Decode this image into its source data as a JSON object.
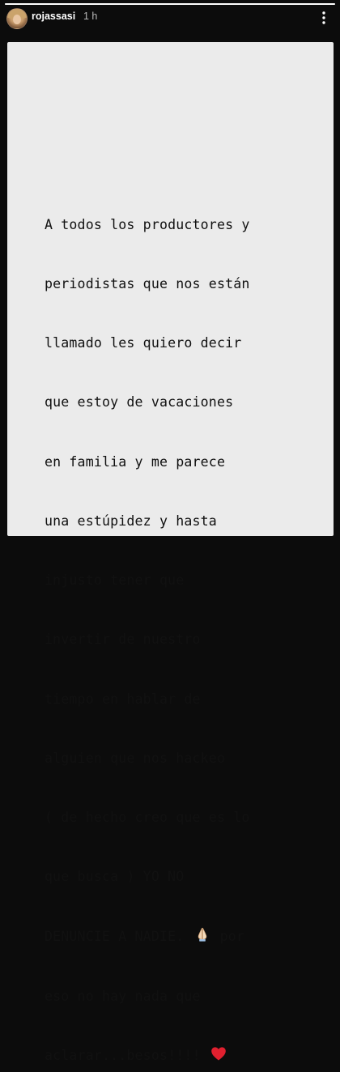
{
  "story": {
    "progress": 1.0,
    "username": "rojassasi",
    "timestamp": "1 h",
    "menu_icon": "more-dots-icon"
  },
  "message": {
    "lines": [
      "A todos los productores y",
      "periodistas que nos están",
      "llamado les quiero decir",
      "que estoy de vacaciones",
      "en familia y me parece",
      "una estúpidez y hasta",
      "injusto tener que",
      "invertir de nuestro",
      "tiempo en hablar de",
      "alguien que nos hackeo",
      "( de hecho creo que es lo",
      "que busca ) YO NO",
      "DENUNCIE A NADIE. ",
      "eso no hay nada que",
      "aclarar...besos!!!! "
    ],
    "line13_after_emoji": " por",
    "emojis": {
      "praying_hands": "praying-hands-icon",
      "heart": "red-heart-icon"
    },
    "heart_color": "#e0202f"
  },
  "colors": {
    "background": "#0c0c0c",
    "card": "#ebebeb",
    "text": "#111111"
  }
}
